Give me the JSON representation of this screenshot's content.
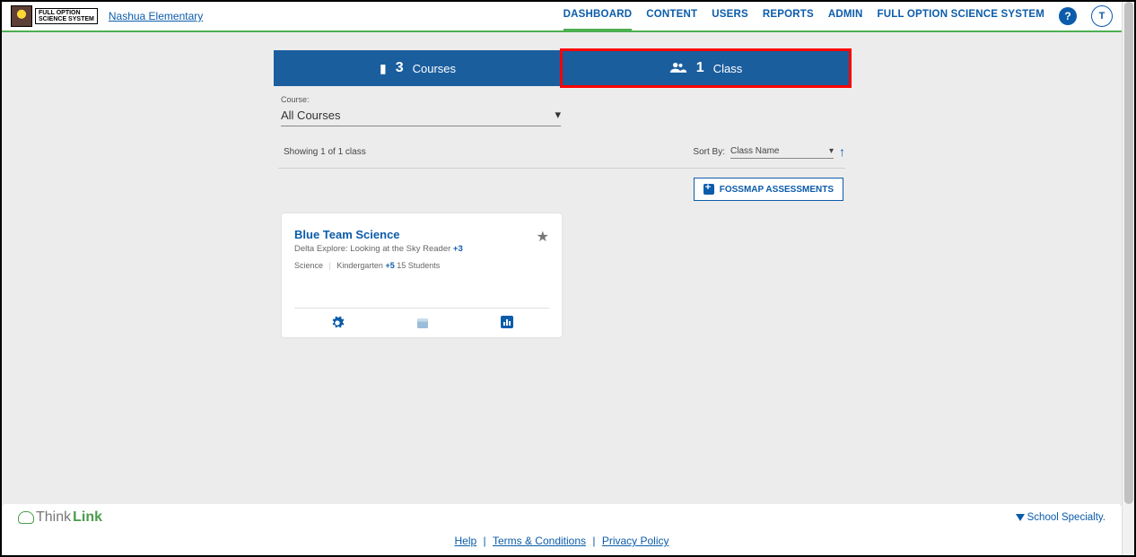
{
  "header": {
    "logo_text_line1": "FULL OPTION",
    "logo_text_line2": "SCIENCE SYSTEM",
    "school_name": "Nashua Elementary",
    "nav": {
      "dashboard": "DASHBOARD",
      "content": "CONTENT",
      "users": "USERS",
      "reports": "REPORTS",
      "admin": "ADMIN",
      "foss": "FULL OPTION SCIENCE SYSTEM"
    },
    "help_glyph": "?",
    "avatar_letter": "T"
  },
  "tabs": {
    "courses": {
      "count": "3",
      "label": "Courses"
    },
    "classes": {
      "count": "1",
      "label": "Class"
    }
  },
  "filter": {
    "label": "Course:",
    "value": "All Courses"
  },
  "results": {
    "showing": "Showing 1 of 1 class",
    "sortby_label": "Sort By:",
    "sort_value": "Class Name"
  },
  "buttons": {
    "fossmap": "FOSSMAP ASSESSMENTS"
  },
  "card": {
    "title": "Blue Team Science",
    "subtitle_prefix": "Delta Explore: Looking at the Sky Reader ",
    "subtitle_plus": "+3",
    "subject": "Science",
    "grade": "Kindergarten ",
    "grade_plus": "+5",
    "students": " 15 Students"
  },
  "footer": {
    "brand_thin": "Think",
    "brand_bold": "Link",
    "school_specialty": "School Specialty.",
    "links": {
      "help": "Help",
      "terms": "Terms & Conditions",
      "privacy": "Privacy Policy"
    }
  }
}
